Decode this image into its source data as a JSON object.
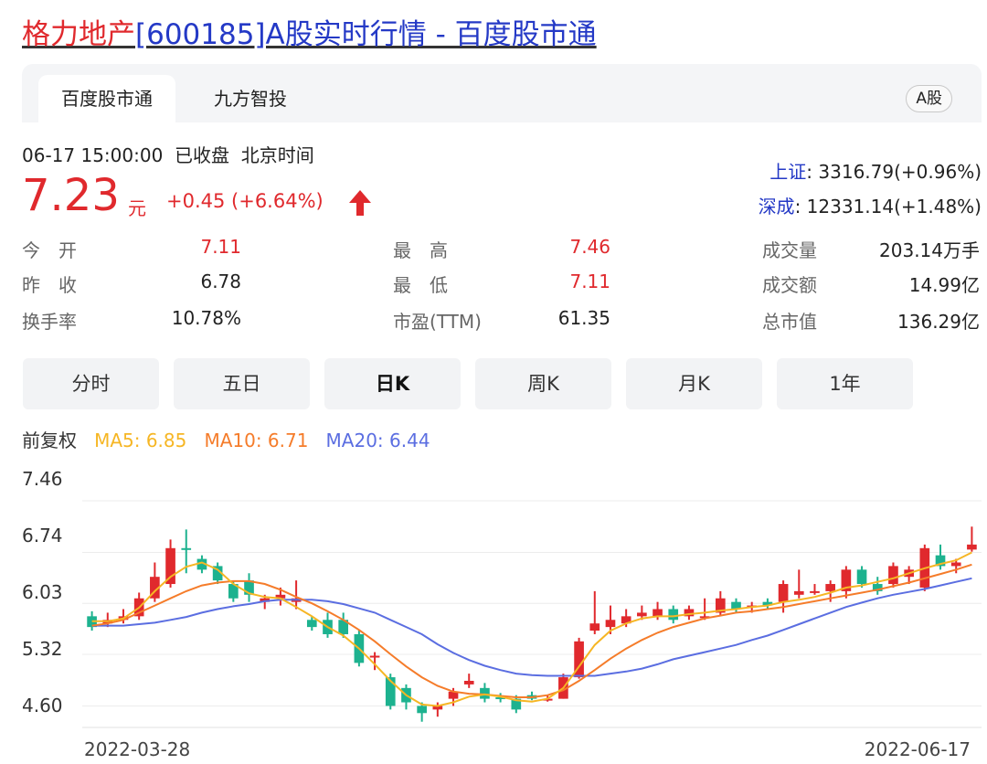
{
  "title": {
    "name_part": "格力地产",
    "rest_part": "[600185]A股实时行情 - 百度股市通"
  },
  "tabs": [
    {
      "label": "百度股市通",
      "active": true
    },
    {
      "label": "九方智投",
      "active": false
    }
  ],
  "market_badge": "A股",
  "quote": {
    "datetime": "06-17 15:00:00",
    "status": "已收盘",
    "timezone": "北京时间",
    "price": "7.23",
    "unit": "元",
    "change": "+0.45 (+6.64%)",
    "up_color": "#e0292d",
    "down_color": "#1db28f"
  },
  "indices": [
    {
      "name": "上证",
      "value": ": 3316.79(+0.96%)"
    },
    {
      "name": "深成",
      "value": ": 12331.14(+1.48%)"
    }
  ],
  "stats": {
    "open_label": "今　开",
    "open": "7.11",
    "prev_label": "昨　收",
    "prev": "6.78",
    "turnover_label": "换手率",
    "turnover": "10.78%",
    "high_label": "最　高",
    "high": "7.46",
    "low_label": "最　低",
    "low": "7.11",
    "pe_label": "市盈(TTM)",
    "pe": "61.35",
    "volume_label": "成交量",
    "volume": "203.14万手",
    "amount_label": "成交额",
    "amount": "14.99亿",
    "mcap_label": "总市值",
    "mcap": "136.29亿"
  },
  "period_buttons": [
    {
      "label": "分时",
      "active": false
    },
    {
      "label": "五日",
      "active": false
    },
    {
      "label": "日K",
      "active": true
    },
    {
      "label": "周K",
      "active": false
    },
    {
      "label": "月K",
      "active": false
    },
    {
      "label": "1年",
      "active": false
    }
  ],
  "ma_legend": {
    "adjust": "前复权",
    "ma5": "MA5: 6.85",
    "ma10": "MA10: 6.71",
    "ma20": "MA20: 6.44",
    "ma5_color": "#f6b624",
    "ma10_color": "#f57c2a",
    "ma20_color": "#5b6ee1"
  },
  "chart_data": {
    "type": "candlestick",
    "y_ticks": [
      "7.46",
      "6.74",
      "6.03",
      "5.32",
      "4.60"
    ],
    "ylim": [
      4.3,
      7.46
    ],
    "x_start_label": "2022-03-28",
    "x_end_label": "2022-06-17",
    "grid": true,
    "candles": [
      {
        "o": 5.85,
        "c": 5.7,
        "h": 5.92,
        "l": 5.65
      },
      {
        "o": 5.75,
        "c": 5.8,
        "h": 5.9,
        "l": 5.7
      },
      {
        "o": 5.8,
        "c": 5.85,
        "h": 5.95,
        "l": 5.75
      },
      {
        "o": 5.85,
        "c": 6.1,
        "h": 6.18,
        "l": 5.8
      },
      {
        "o": 6.1,
        "c": 6.4,
        "h": 6.6,
        "l": 6.05
      },
      {
        "o": 6.3,
        "c": 6.8,
        "h": 6.92,
        "l": 6.25
      },
      {
        "o": 6.8,
        "c": 6.78,
        "h": 7.06,
        "l": 6.45
      },
      {
        "o": 6.65,
        "c": 6.5,
        "h": 6.7,
        "l": 6.45
      },
      {
        "o": 6.55,
        "c": 6.35,
        "h": 6.6,
        "l": 6.3
      },
      {
        "o": 6.3,
        "c": 6.1,
        "h": 6.35,
        "l": 6.05
      },
      {
        "o": 6.35,
        "c": 6.15,
        "h": 6.45,
        "l": 6.05
      },
      {
        "o": 6.05,
        "c": 6.1,
        "h": 6.15,
        "l": 5.95
      },
      {
        "o": 6.1,
        "c": 6.15,
        "h": 6.25,
        "l": 6.0
      },
      {
        "o": 6.05,
        "c": 6.1,
        "h": 6.35,
        "l": 5.95
      },
      {
        "o": 5.8,
        "c": 5.7,
        "h": 5.85,
        "l": 5.65
      },
      {
        "o": 5.8,
        "c": 5.6,
        "h": 5.9,
        "l": 5.55
      },
      {
        "o": 5.8,
        "c": 5.6,
        "h": 5.9,
        "l": 5.55
      },
      {
        "o": 5.6,
        "c": 5.2,
        "h": 5.65,
        "l": 5.15
      },
      {
        "o": 5.3,
        "c": 5.3,
        "h": 5.35,
        "l": 5.1
      },
      {
        "o": 5.0,
        "c": 4.6,
        "h": 5.05,
        "l": 4.55
      },
      {
        "o": 4.85,
        "c": 4.65,
        "h": 4.9,
        "l": 4.55
      },
      {
        "o": 4.6,
        "c": 4.5,
        "h": 4.65,
        "l": 4.38
      },
      {
        "o": 4.55,
        "c": 4.6,
        "h": 4.65,
        "l": 4.45
      },
      {
        "o": 4.7,
        "c": 4.8,
        "h": 4.85,
        "l": 4.6
      },
      {
        "o": 4.9,
        "c": 4.95,
        "h": 5.05,
        "l": 4.85
      },
      {
        "o": 4.85,
        "c": 4.7,
        "h": 4.92,
        "l": 4.65
      },
      {
        "o": 4.72,
        "c": 4.7,
        "h": 4.78,
        "l": 4.65
      },
      {
        "o": 4.7,
        "c": 4.55,
        "h": 4.75,
        "l": 4.5
      },
      {
        "o": 4.75,
        "c": 4.7,
        "h": 4.8,
        "l": 4.68
      },
      {
        "o": 4.7,
        "c": 4.7,
        "h": 4.74,
        "l": 4.66
      },
      {
        "o": 4.7,
        "c": 5.0,
        "h": 5.05,
        "l": 4.7
      },
      {
        "o": 5.0,
        "c": 5.5,
        "h": 5.55,
        "l": 4.98
      },
      {
        "o": 5.65,
        "c": 5.75,
        "h": 6.2,
        "l": 5.6
      },
      {
        "o": 5.7,
        "c": 5.8,
        "h": 6.0,
        "l": 5.6
      },
      {
        "o": 5.75,
        "c": 5.85,
        "h": 5.95,
        "l": 5.7
      },
      {
        "o": 5.85,
        "c": 5.9,
        "h": 6.0,
        "l": 5.8
      },
      {
        "o": 5.85,
        "c": 5.95,
        "h": 6.05,
        "l": 5.8
      },
      {
        "o": 5.95,
        "c": 5.8,
        "h": 6.0,
        "l": 5.75
      },
      {
        "o": 5.85,
        "c": 5.95,
        "h": 6.0,
        "l": 5.8
      },
      {
        "o": 5.85,
        "c": 5.85,
        "h": 6.1,
        "l": 5.8
      },
      {
        "o": 5.9,
        "c": 6.1,
        "h": 6.2,
        "l": 5.85
      },
      {
        "o": 6.05,
        "c": 5.95,
        "h": 6.1,
        "l": 5.9
      },
      {
        "o": 6.0,
        "c": 6.0,
        "h": 6.05,
        "l": 5.9
      },
      {
        "o": 6.05,
        "c": 6.0,
        "h": 6.1,
        "l": 5.95
      },
      {
        "o": 6.05,
        "c": 6.3,
        "h": 6.35,
        "l": 5.9
      },
      {
        "o": 6.15,
        "c": 6.2,
        "h": 6.5,
        "l": 6.1
      },
      {
        "o": 6.2,
        "c": 6.2,
        "h": 6.3,
        "l": 6.15
      },
      {
        "o": 6.2,
        "c": 6.3,
        "h": 6.35,
        "l": 6.05
      },
      {
        "o": 6.2,
        "c": 6.5,
        "h": 6.55,
        "l": 6.1
      },
      {
        "o": 6.5,
        "c": 6.3,
        "h": 6.55,
        "l": 6.25
      },
      {
        "o": 6.3,
        "c": 6.2,
        "h": 6.4,
        "l": 6.15
      },
      {
        "o": 6.3,
        "c": 6.55,
        "h": 6.6,
        "l": 6.25
      },
      {
        "o": 6.4,
        "c": 6.5,
        "h": 6.55,
        "l": 6.3
      },
      {
        "o": 6.25,
        "c": 6.8,
        "h": 6.85,
        "l": 6.2
      },
      {
        "o": 6.7,
        "c": 6.55,
        "h": 6.85,
        "l": 6.5
      },
      {
        "o": 6.55,
        "c": 6.6,
        "h": 6.65,
        "l": 6.45
      },
      {
        "o": 6.78,
        "c": 6.85,
        "h": 7.1,
        "l": 6.75
      }
    ],
    "ma5": [
      5.78,
      5.78,
      5.82,
      5.97,
      6.2,
      6.4,
      6.54,
      6.6,
      6.5,
      6.3,
      6.17,
      6.12,
      6.1,
      5.98,
      5.85,
      5.7,
      5.58,
      5.4,
      5.18,
      4.95,
      4.75,
      4.62,
      4.6,
      4.65,
      4.73,
      4.76,
      4.73,
      4.68,
      4.66,
      4.7,
      4.85,
      5.15,
      5.45,
      5.65,
      5.75,
      5.82,
      5.85,
      5.85,
      5.88,
      5.9,
      5.93,
      5.95,
      5.98,
      6.0,
      6.05,
      6.08,
      6.12,
      6.18,
      6.25,
      6.28,
      6.33,
      6.38,
      6.45,
      6.52,
      6.58,
      6.63,
      6.74
    ],
    "ma10": [
      5.72,
      5.75,
      5.8,
      5.9,
      6.0,
      6.1,
      6.2,
      6.28,
      6.32,
      6.34,
      6.34,
      6.3,
      6.22,
      6.12,
      6.03,
      5.92,
      5.8,
      5.66,
      5.5,
      5.32,
      5.15,
      5.0,
      4.88,
      4.8,
      4.77,
      4.76,
      4.74,
      4.72,
      4.72,
      4.75,
      4.82,
      4.95,
      5.1,
      5.26,
      5.4,
      5.52,
      5.62,
      5.7,
      5.76,
      5.82,
      5.86,
      5.9,
      5.92,
      5.95,
      5.98,
      6.02,
      6.06,
      6.1,
      6.14,
      6.18,
      6.22,
      6.27,
      6.32,
      6.38,
      6.44,
      6.5,
      6.57
    ],
    "ma20": [
      5.72,
      5.72,
      5.72,
      5.74,
      5.76,
      5.8,
      5.84,
      5.9,
      5.95,
      5.99,
      6.02,
      6.06,
      6.08,
      6.08,
      6.08,
      6.06,
      6.02,
      5.96,
      5.9,
      5.8,
      5.7,
      5.6,
      5.46,
      5.34,
      5.24,
      5.16,
      5.1,
      5.05,
      5.03,
      5.02,
      5.02,
      5.02,
      5.02,
      5.05,
      5.08,
      5.12,
      5.18,
      5.25,
      5.3,
      5.35,
      5.4,
      5.45,
      5.52,
      5.58,
      5.66,
      5.74,
      5.82,
      5.9,
      5.98,
      6.04,
      6.1,
      6.15,
      6.19,
      6.23,
      6.28,
      6.33,
      6.38
    ]
  }
}
